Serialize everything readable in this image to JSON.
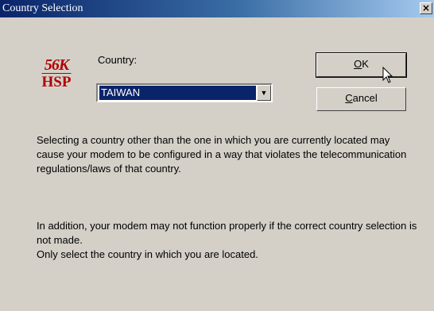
{
  "window": {
    "title": "Country Selection",
    "close_glyph": "×"
  },
  "logo": {
    "text_top": "56K",
    "text_bottom": "HSP",
    "color": "#b00000"
  },
  "country": {
    "label": "Country:",
    "selected": "TAIWAN"
  },
  "buttons": {
    "ok": {
      "mnemonic": "O",
      "rest": "K"
    },
    "cancel": {
      "mnemonic": "C",
      "rest": "ancel"
    }
  },
  "messages": {
    "warning": "Selecting a country other than the one in which you are currently located may cause your modem to be configured in a way that violates the telecommunication regulations/laws of that country.",
    "addition": "In addition, your modem may not function properly if the correct country selection is not made.",
    "instruction": "Only select the country in which you are located."
  },
  "colors": {
    "titlebar_start": "#0a246a",
    "titlebar_end": "#a6caf0",
    "selection": "#0a246a",
    "face": "#d4d0c8"
  }
}
